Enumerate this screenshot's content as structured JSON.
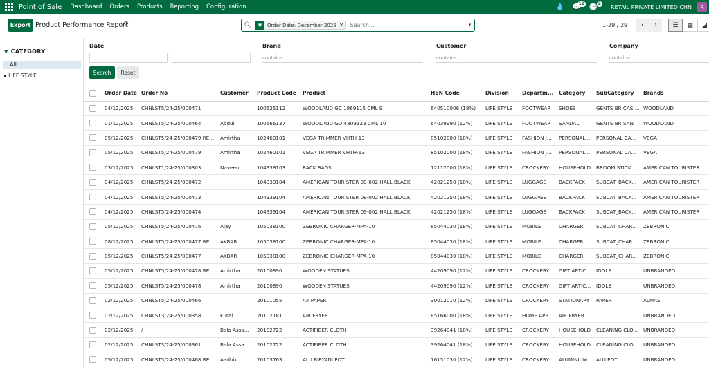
{
  "navbar": {
    "brand": "Point of Sale",
    "menu": [
      "Dashboard",
      "Orders",
      "Products",
      "Reporting",
      "Configuration"
    ],
    "messages_count": "12",
    "activity_count": "2",
    "company": "RETAIL PRIVATE LIMITED CHN",
    "avatar_letter": "R"
  },
  "control": {
    "export_label": "Export",
    "title": "Product Performance Report",
    "facet_label": "Order Date: December 2025",
    "search_placeholder": "Search...",
    "pager": "1-29 / 29"
  },
  "sidebar": {
    "title": "CATEGORY",
    "all_label": "All",
    "items": [
      {
        "label": "LIFE STYLE"
      }
    ]
  },
  "filters": {
    "date_label": "Date",
    "brand_label": "Brand",
    "brand_placeholder": "contains.... .",
    "customer_label": "Customer",
    "customer_placeholder": "contains.... .",
    "company_label": "Company",
    "company_placeholder": "contains.... .",
    "search_button": "Search",
    "reset_button": "Reset"
  },
  "table": {
    "columns": [
      "Order Date",
      "Order No",
      "Customer",
      "Product Code",
      "Product",
      "HSN Code",
      "Division",
      "Departm...",
      "Category",
      "SubCategory",
      "Brands"
    ],
    "rows": [
      [
        "04/12/2025",
        "CHNLST5/24-25/000471",
        "",
        "100525112",
        "WOODLAND GC 1869115 CML 9",
        "640510006 (18%)",
        "LIFE STYLE",
        "FOOTWEAR",
        "SHOES",
        "GENTS BR CAS ...",
        "WOODLAND"
      ],
      [
        "01/12/2025",
        "CHNLST5/24-25/000464",
        "Abdul",
        "100566137",
        "WOODLAND GD 4809123 CML 10",
        "64039990 (12%)",
        "LIFE STYLE",
        "FOOTWEAR",
        "SANDAL",
        "GENTS BR SAN",
        "WOODLAND"
      ],
      [
        "05/12/2025",
        "CHNLST5/24-25/000479 RE...",
        "Amirtha",
        "102460101",
        "VEGA TRIMMER VHTH-13",
        "85102000 (18%)",
        "LIFE STYLE",
        "FASHION J...",
        "PERSONAL...",
        "PERSONAL CA...",
        "VEGA"
      ],
      [
        "05/12/2025",
        "CHNLST5/24-25/000479",
        "Amirtha",
        "102460101",
        "VEGA TRIMMER VHTH-13",
        "85102000 (18%)",
        "LIFE STYLE",
        "FASHION J...",
        "PERSONAL...",
        "PERSONAL CA...",
        "VEGA"
      ],
      [
        "03/12/2025",
        "CHNLST1/24-25/000303",
        "Naveen",
        "104339103",
        "BACK BAGS",
        "12112000 (18%)",
        "LIFE STYLE",
        "CROCKERY",
        "HOUSEHOLD",
        "BROOM STICK",
        "AMERICAN TOURISTER"
      ],
      [
        "04/12/2025",
        "CHNLST5/24-25/000472",
        "",
        "104339104",
        "AMERICAN TOURISTER 09-002 HALL BLACK",
        "42021250 (18%)",
        "LIFE STYLE",
        "LUGGAGE",
        "BACKPACK",
        "SUBCAT_BACK...",
        "AMERICAN TOURISTER"
      ],
      [
        "04/12/2025",
        "CHNLST5/24-25/000473",
        "",
        "104339104",
        "AMERICAN TOURISTER 09-002 HALL BLACK",
        "42021250 (18%)",
        "LIFE STYLE",
        "LUGGAGE",
        "BACKPACK",
        "SUBCAT_BACK...",
        "AMERICAN TOURISTER"
      ],
      [
        "04/12/2025",
        "CHNLST5/24-25/000474",
        "",
        "104339104",
        "AMERICAN TOURISTER 09-002 HALL BLACK",
        "42021250 (18%)",
        "LIFE STYLE",
        "LUGGAGE",
        "BACKPACK",
        "SUBCAT_BACK...",
        "AMERICAN TOURISTER"
      ],
      [
        "05/12/2025",
        "CHNLST5/24-25/000476",
        "Ajay",
        "105038100",
        "ZEBRONIC CHARGER-MPA-10",
        "85044030 (18%)",
        "LIFE STYLE",
        "MOBILE",
        "CHARGER",
        "SUBCAT_CHAR...",
        "ZEBRONIC"
      ],
      [
        "08/12/2025",
        "CHNLST5/24-25/000477 RE...",
        "AKBAR",
        "105038100",
        "ZEBRONIC CHARGER-MPA-10",
        "85044030 (18%)",
        "LIFE STYLE",
        "MOBILE",
        "CHARGER",
        "SUBCAT_CHAR...",
        "ZEBRONIC"
      ],
      [
        "05/12/2025",
        "CHNLST5/24-25/000477",
        "AKBAR",
        "105038100",
        "ZEBRONIC CHARGER-MPA-10",
        "85044030 (18%)",
        "LIFE STYLE",
        "MOBILE",
        "CHARGER",
        "SUBCAT_CHAR...",
        "ZEBRONIC"
      ],
      [
        "05/12/2025",
        "CHNLST5/24-25/000478 RE...",
        "Amirtha",
        "20100890",
        "WOODEN STATUES",
        "44209090 (12%)",
        "LIFE STYLE",
        "CROCKERY",
        "GIFT ARTIC...",
        "IDOLS",
        "UNBRANDED"
      ],
      [
        "05/12/2025",
        "CHNLST5/24-25/000478",
        "Amirtha",
        "20100890",
        "WOODEN STATUES",
        "44209090 (12%)",
        "LIFE STYLE",
        "CROCKERY",
        "GIFT ARTIC...",
        "IDOLS",
        "UNBRANDED"
      ],
      [
        "02/12/2025",
        "CHNLST5/24-25/000466",
        "",
        "20101055",
        "A4 PAPER",
        "30012010 (12%)",
        "LIFE STYLE",
        "CROCKERY",
        "STATIONARY",
        "PAPER",
        "ALMAS"
      ],
      [
        "02/12/2025",
        "CHNLST3/24-25/000358",
        "Kural",
        "20102181",
        "AIR FRYER",
        "85166000 (18%)",
        "LIFE STYLE",
        "HOME APP...",
        "AIR FRYER",
        "",
        "UNBRANDED"
      ],
      [
        "02/12/2025",
        "/",
        "Bala Assa...",
        "20102722",
        "ACTIFIBER CLOTH",
        "39264041 (18%)",
        "LIFE STYLE",
        "CROCKERY",
        "HOUSEHOLD",
        "CLEANING CLO...",
        "UNBRANDED"
      ],
      [
        "02/12/2025",
        "CHNLST3/24-25/000361",
        "Bala Assa...",
        "20102722",
        "ACTIFIBER CLOTH",
        "39264041 (18%)",
        "LIFE STYLE",
        "CROCKERY",
        "HOUSEHOLD",
        "CLEANING CLO...",
        "UNBRANDED"
      ],
      [
        "05/12/2025",
        "CHNLST5/24-25/000468 RE...",
        "Aadhik",
        "20103763",
        "ALU BIRYANI POT",
        "76151030 (12%)",
        "LIFE STYLE",
        "CROCKERY",
        "ALUMINIUM",
        "ALU POT",
        "UNBRANDED"
      ]
    ]
  }
}
